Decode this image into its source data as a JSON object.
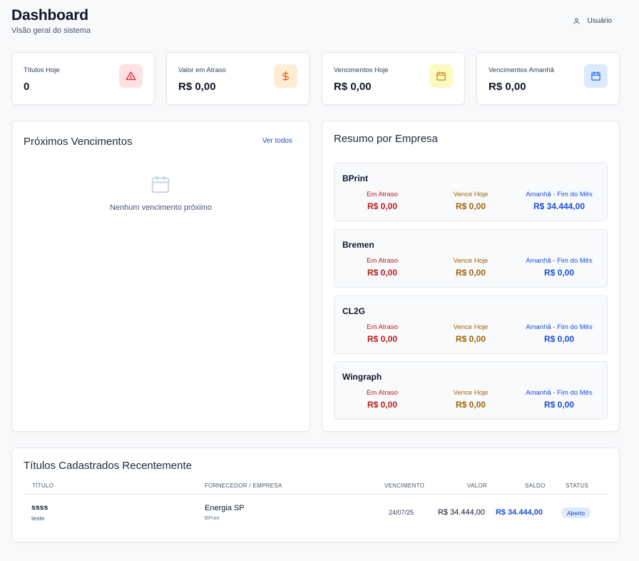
{
  "header": {
    "title": "Dashboard",
    "subtitle": "Visão geral do sistema",
    "user_label": "Usuário"
  },
  "stats": [
    {
      "label": "Títulos Hoje",
      "value": "0",
      "icon": "alert-triangle-icon",
      "color": "#dc2626",
      "bg": "#fee2e2"
    },
    {
      "label": "Valor em Atraso",
      "value": "R$ 0,00",
      "icon": "dollar-icon",
      "color": "#ea580c",
      "bg": "#ffedd5"
    },
    {
      "label": "Vencimentos Hoje",
      "value": "R$ 0,00",
      "icon": "calendar-icon",
      "color": "#ca8a04",
      "bg": "#fef9c3"
    },
    {
      "label": "Vencimentos Amanhã",
      "value": "R$ 0,00",
      "icon": "calendar-icon",
      "color": "#2563eb",
      "bg": "#dbeafe"
    }
  ],
  "upcoming": {
    "title": "Próximos Vencimentos",
    "link": "Ver todos",
    "empty_text": "Nenhum vencimento próximo"
  },
  "summary": {
    "title": "Resumo por Empresa",
    "labels": {
      "overdue": "Em Atraso",
      "today": "Vence Hoje",
      "upcoming": "Amanhã - Fim do Mês"
    },
    "companies": [
      {
        "name": "BPrint",
        "overdue": "R$ 0,00",
        "today": "R$ 0,00",
        "upcoming": "R$ 34.444,00"
      },
      {
        "name": "Bremen",
        "overdue": "R$ 0,00",
        "today": "R$ 0,00",
        "upcoming": "R$ 0,00"
      },
      {
        "name": "CL2G",
        "overdue": "R$ 0,00",
        "today": "R$ 0,00",
        "upcoming": "R$ 0,00"
      },
      {
        "name": "Wingraph",
        "overdue": "R$ 0,00",
        "today": "R$ 0,00",
        "upcoming": "R$ 0,00"
      }
    ]
  },
  "recent": {
    "title": "Títulos Cadastrados Recentemente",
    "columns": [
      "Título",
      "Fornecedor / Empresa",
      "Vencimento",
      "Valor",
      "Saldo",
      "Status"
    ],
    "rows": [
      {
        "title": "ssss",
        "description": "teste",
        "supplier": "Energia SP",
        "company": "BPrint",
        "due": "24/07/25",
        "value": "R$ 34.444,00",
        "balance": "R$ 34.444,00",
        "status": "Aberto"
      }
    ]
  },
  "colors": {
    "overdue": "#b91c1c",
    "today": "#a16207",
    "upcoming": "#1d4ed8"
  }
}
